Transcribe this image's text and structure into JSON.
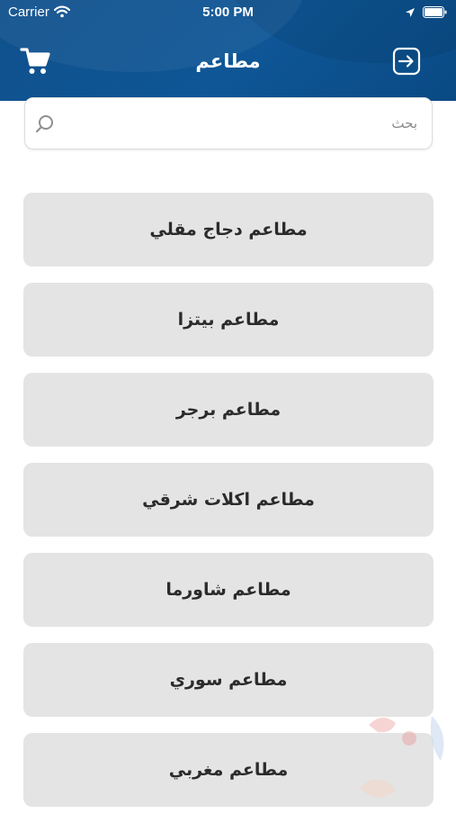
{
  "status_bar": {
    "carrier": "Carrier",
    "time": "5:00 PM"
  },
  "header": {
    "title": "مطاعم",
    "background_color": "#0e5696",
    "left_icon": "cart-icon",
    "right_icon": "logout-icon"
  },
  "search": {
    "placeholder": "بحث",
    "value": "",
    "icon": "search-icon"
  },
  "categories": [
    {
      "label": "مطاعم دجاج مقلي"
    },
    {
      "label": "مطاعم بيتزا"
    },
    {
      "label": "مطاعم برجر"
    },
    {
      "label": "مطاعم اكلات شرقي"
    },
    {
      "label": "مطاعم شاورما"
    },
    {
      "label": "مطاعم سوري"
    },
    {
      "label": "مطاعم مغربي"
    }
  ],
  "colors": {
    "item_background": "#e4e4e4",
    "item_text": "#2b2b2b"
  }
}
